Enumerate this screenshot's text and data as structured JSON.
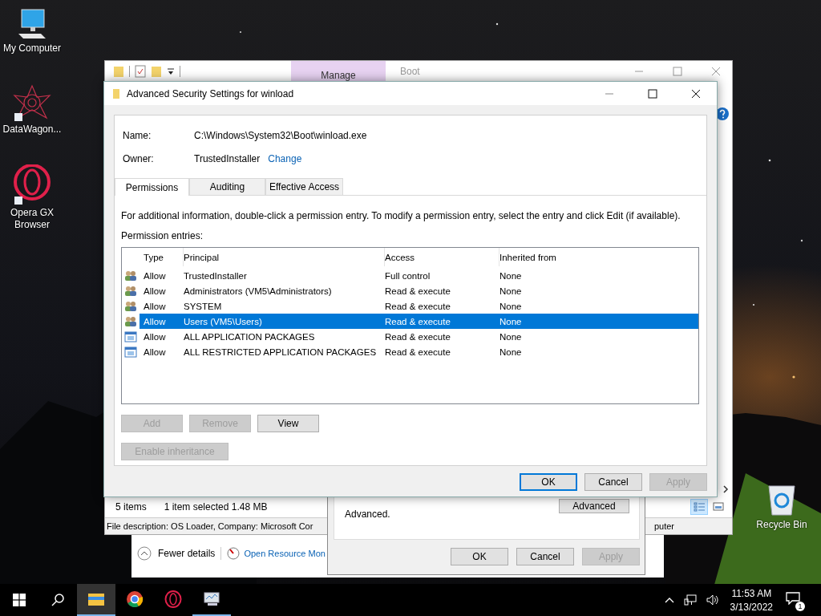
{
  "desktop_icons": [
    {
      "label": "My Computer",
      "kind": "computer"
    },
    {
      "label": "DataWagon...",
      "kind": "burst"
    },
    {
      "label": "Opera GX Browser",
      "kind": "opera"
    }
  ],
  "recycle_bin": {
    "label": "Recycle Bin"
  },
  "task_manager": {
    "toggle": "Fewer details",
    "link": "Open Resource Mon"
  },
  "explorer": {
    "ribbon_tab": "Manage",
    "title": "Boot",
    "item_count": "5 items",
    "selection": "1 item selected  1.48 MB",
    "description": "File description: OS Loader, Company: Microsoft Cor",
    "description_tail": "puter"
  },
  "properties": {
    "text": "Advanced.",
    "advanced_button": "Advanced",
    "buttons": [
      {
        "label": "OK",
        "disabled": false
      },
      {
        "label": "Cancel",
        "disabled": false
      },
      {
        "label": "Apply",
        "disabled": true
      }
    ]
  },
  "security_dialog": {
    "title": "Advanced Security Settings for winload",
    "name_label": "Name:",
    "name": "C:\\Windows\\System32\\Boot\\winload.exe",
    "owner_label": "Owner:",
    "owner": "TrustedInstaller",
    "change_link": "Change",
    "tabs": [
      {
        "label": "Permissions",
        "selected": true
      },
      {
        "label": "Auditing",
        "selected": false
      },
      {
        "label": "Effective Access",
        "selected": false
      }
    ],
    "info": "For additional information, double-click a permission entry. To modify a permission entry, select the entry and click Edit (if available).",
    "entries_label": "Permission entries:",
    "columns": [
      "Type",
      "Principal",
      "Access",
      "Inherited from"
    ],
    "rows": [
      {
        "kind": "group",
        "type": "Allow",
        "principal": "TrustedInstaller",
        "access": "Full control",
        "inherited": "None",
        "selected": false
      },
      {
        "kind": "group",
        "type": "Allow",
        "principal": "Administrators (VM5\\Administrators)",
        "access": "Read & execute",
        "inherited": "None",
        "selected": false
      },
      {
        "kind": "group",
        "type": "Allow",
        "principal": "SYSTEM",
        "access": "Read & execute",
        "inherited": "None",
        "selected": false
      },
      {
        "kind": "group",
        "type": "Allow",
        "principal": "Users (VM5\\Users)",
        "access": "Read & execute",
        "inherited": "None",
        "selected": true
      },
      {
        "kind": "package",
        "type": "Allow",
        "principal": "ALL APPLICATION PACKAGES",
        "access": "Read & execute",
        "inherited": "None",
        "selected": false
      },
      {
        "kind": "package",
        "type": "Allow",
        "principal": "ALL RESTRICTED APPLICATION PACKAGES",
        "access": "Read & execute",
        "inherited": "None",
        "selected": false
      }
    ],
    "entry_buttons": [
      {
        "label": "Add",
        "disabled": true
      },
      {
        "label": "Remove",
        "disabled": true
      },
      {
        "label": "View",
        "disabled": false
      }
    ],
    "inheritance_button": {
      "label": "Enable inheritance",
      "disabled": true
    },
    "footer_buttons": [
      {
        "label": "OK",
        "disabled": false,
        "default": true
      },
      {
        "label": "Cancel",
        "disabled": false,
        "default": false
      },
      {
        "label": "Apply",
        "disabled": true,
        "default": false
      }
    ]
  },
  "taskbar": {
    "apps": [
      {
        "kind": "explorer",
        "selected": true,
        "open": true
      },
      {
        "kind": "chrome",
        "selected": false,
        "open": false
      },
      {
        "kind": "opera",
        "selected": false,
        "open": false
      },
      {
        "kind": "monitor",
        "selected": false,
        "open": true
      }
    ],
    "time": "11:53 AM",
    "date": "3/13/2022",
    "notifications": "1"
  }
}
